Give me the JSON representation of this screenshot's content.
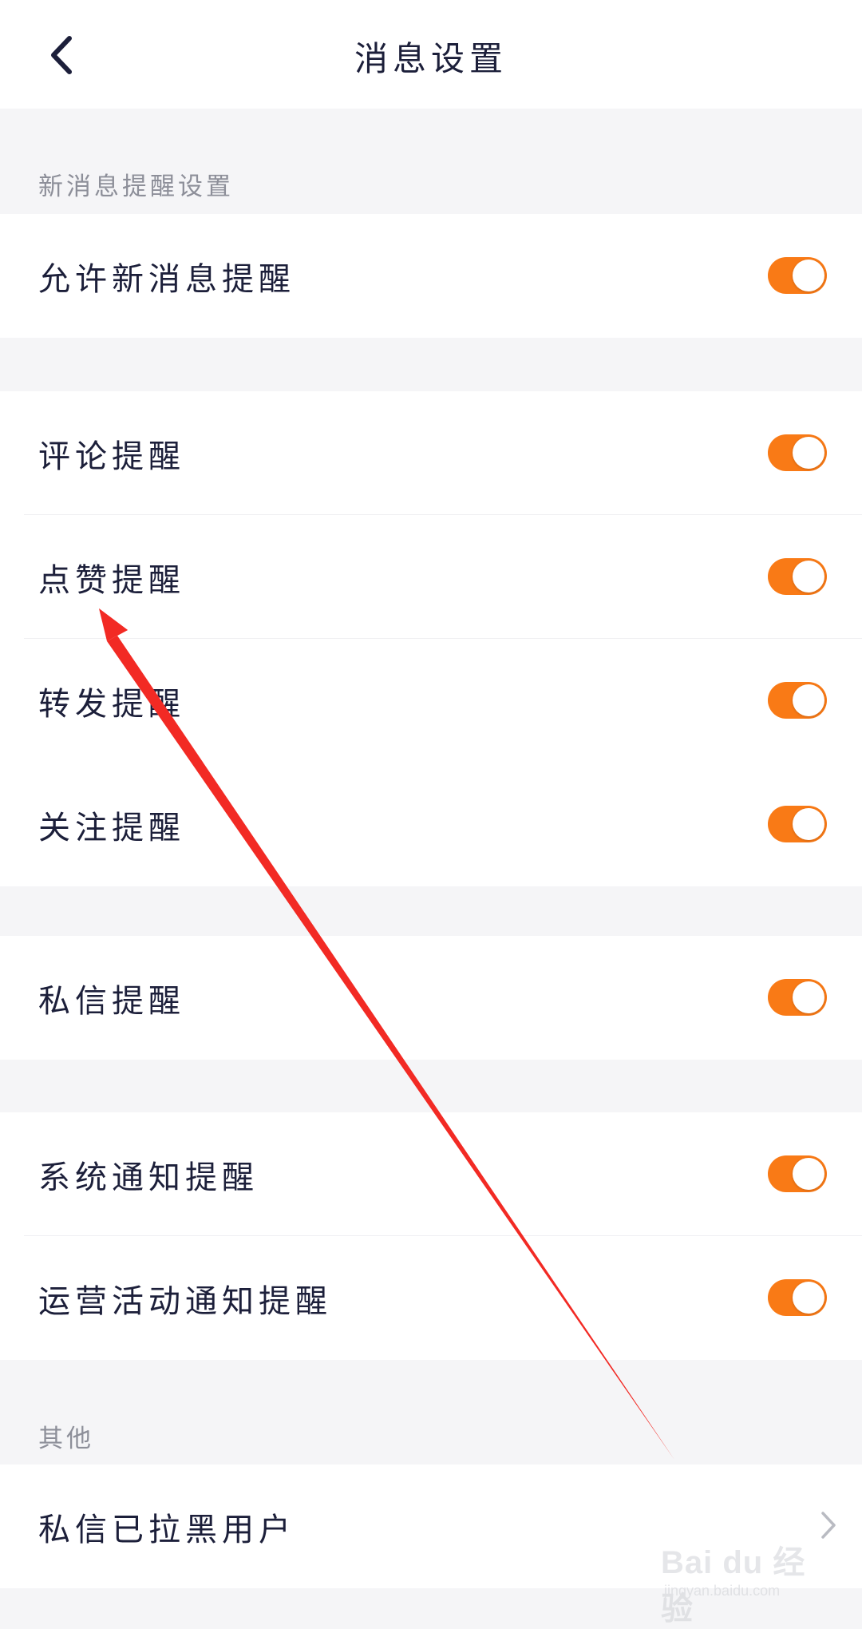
{
  "header": {
    "title": "消息设置",
    "back_icon": "chevron-left-icon"
  },
  "sections": {
    "new_message_header": "新消息提醒设置",
    "other_header": "其他"
  },
  "settings": {
    "allow_new_message": {
      "label": "允许新消息提醒",
      "enabled": true
    },
    "comment": {
      "label": "评论提醒",
      "enabled": true
    },
    "like": {
      "label": "点赞提醒",
      "enabled": true
    },
    "repost": {
      "label": "转发提醒",
      "enabled": true
    },
    "follow": {
      "label": "关注提醒",
      "enabled": true
    },
    "private_message": {
      "label": "私信提醒",
      "enabled": true
    },
    "system_notice": {
      "label": "系统通知提醒",
      "enabled": true
    },
    "operation_activity": {
      "label": "运营活动通知提醒",
      "enabled": true
    },
    "blocked_users": {
      "label": "私信已拉黑用户"
    }
  },
  "colors": {
    "toggle_on": "#f97a16",
    "annotation_arrow": "#f22a24",
    "background": "#f5f5f7"
  },
  "watermark": {
    "main": "Bai du 经验",
    "sub": "jingyan.baidu.com"
  }
}
